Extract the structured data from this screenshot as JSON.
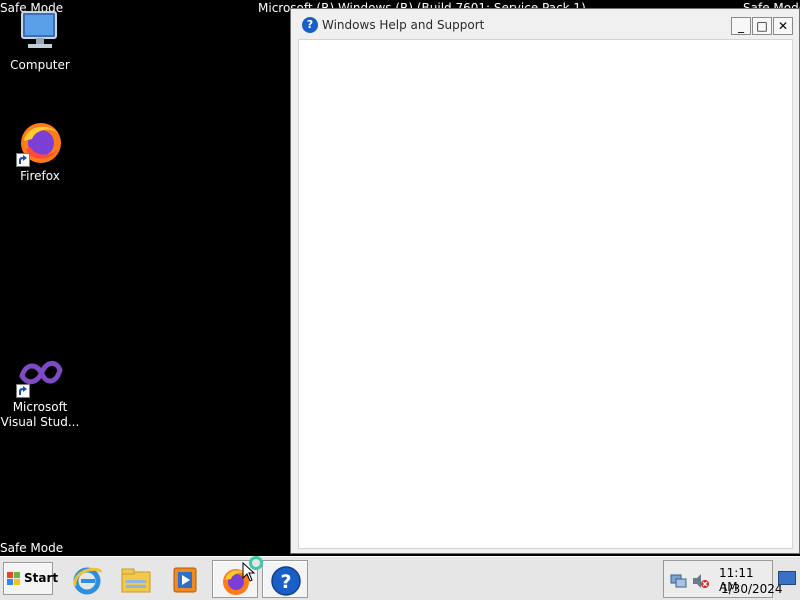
{
  "overlay": {
    "safe_mode_top_left": "Safe Mode",
    "safe_mode_bottom_left": "Safe Mode",
    "os_info": "Microsoft (R) Windows (R) (Build 7601: Service Pack 1)",
    "safe_mode_top_right": "Safe Mode"
  },
  "desktop": {
    "icons": [
      {
        "label": "Computer",
        "icon": "computer-icon"
      },
      {
        "label": "Firefox",
        "icon": "firefox-icon"
      },
      {
        "label": "Microsoft Visual Stud...",
        "icon": "visual-studio-icon"
      }
    ]
  },
  "help_window": {
    "title": "Windows Help and Support",
    "icon": "help-icon",
    "title_icon_glyph": "?",
    "minimize_glyph": "_",
    "maximize_glyph": "□",
    "close_glyph": "✕"
  },
  "taskbar": {
    "start_label": "Start",
    "pinned": [
      {
        "icon": "internet-explorer-icon"
      },
      {
        "icon": "windows-explorer-icon"
      },
      {
        "icon": "media-player-icon"
      },
      {
        "icon": "firefox-icon"
      },
      {
        "icon": "help-icon"
      }
    ],
    "clock_time": "11:11 AM",
    "clock_date": "1/30/2024"
  },
  "colors": {
    "desktop_background": "#000000",
    "help_blue": "#1a5fc8",
    "taskbar": "#e6e6e6"
  }
}
